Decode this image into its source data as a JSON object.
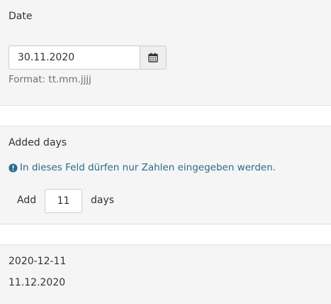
{
  "date_section": {
    "label": "Date",
    "input_value": "30.11.2020",
    "format_hint": "Format: tt.mm.jjjj",
    "calendar_icon": "calendar-icon"
  },
  "days_section": {
    "label": "Added days",
    "info_message": "In dieses Feld dürfen nur Zahlen eingegeben werden.",
    "info_icon": "exclamation-circle-icon",
    "info_color": "#2b6a8c",
    "add_label": "Add",
    "days_value": "11",
    "days_label": "days"
  },
  "result_section": {
    "iso_date": "2020-12-11",
    "de_date": "11.12.2020"
  }
}
